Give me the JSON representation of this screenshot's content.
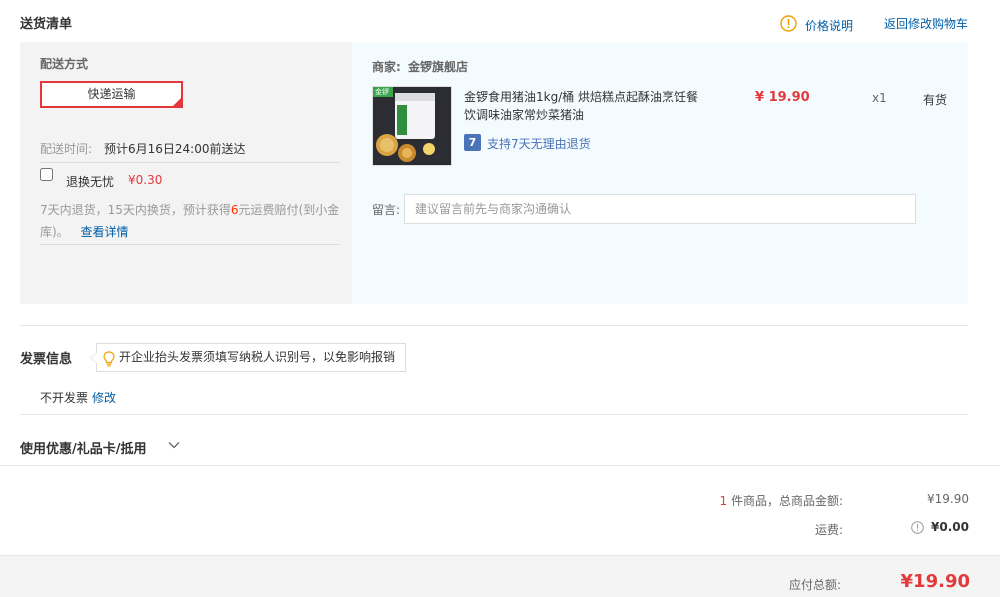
{
  "header": {
    "title": "送货清单",
    "price_note": "价格说明",
    "back_cart": "返回修改购物车"
  },
  "shipping": {
    "label": "配送方式",
    "method": "快递运输",
    "time_label": "配送时间:",
    "time_value": "预计6月16日24:00前送达",
    "service_name": "退换无忧",
    "service_price": "¥0.30",
    "desc_part1": "7天内退货，15天内换货，预计获得",
    "desc_highlight": "6",
    "desc_part2": "元运费赔付(到小金",
    "desc_part3": "库)。",
    "details_link": "查看详情"
  },
  "goods": {
    "merchant_label": "商家:",
    "merchant_name": "金锣旗舰店",
    "product_line1": "金锣食用猪油1kg/桶 烘焙糕点起酥油烹饪餐",
    "product_line2": "饮调味油家常炒菜猪油",
    "price": "¥ 19.90",
    "quantity": "x1",
    "stock": "有货",
    "return_icon_char": "7",
    "return_policy": "支持7天无理由退货",
    "remark_label": "留言:",
    "remark_placeholder": "建议留言前先与商家沟通确认",
    "brand_mark": "金锣"
  },
  "invoice": {
    "title": "发票信息",
    "tip": "开企业抬头发票须填写纳税人识别号，以免影响报销",
    "status": "不开发票",
    "edit_link": "修改"
  },
  "coupon": {
    "title": "使用优惠/礼品卡/抵用"
  },
  "summary": {
    "count": "1",
    "count_label": "件商品，总商品金额:",
    "total": "¥19.90",
    "shipping_label": "运费:",
    "shipping_fee": "¥0.00",
    "payable_label": "应付总额:",
    "payable": "¥19.90"
  },
  "colors": {
    "accent_red": "#e4393c",
    "link_blue": "#005ea7",
    "info_orange": "#f0a000"
  }
}
